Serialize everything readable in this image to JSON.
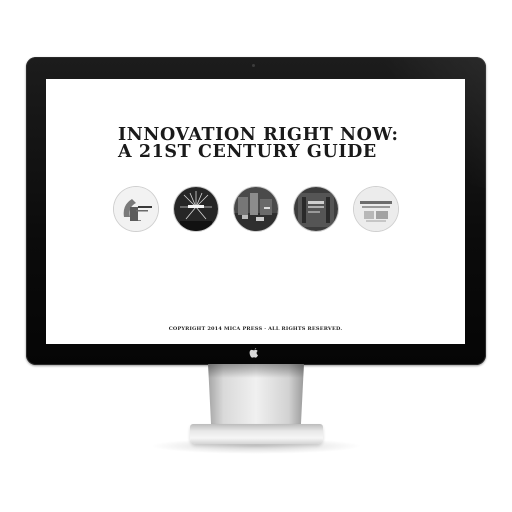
{
  "page": {
    "title_line1": "INNOVATION RIGHT NOW:",
    "title_line2": "A 21ST CENTURY GUIDE",
    "copyright": "COPYRIGHT 2014 MICA PRESS · ALL RIGHTS RESERVED."
  },
  "thumbnails": [
    {
      "icon": "introduction-thumbnail"
    },
    {
      "icon": "fireworks-thumbnail"
    },
    {
      "icon": "street-scene-thumbnail"
    },
    {
      "icon": "building-facade-thumbnail"
    },
    {
      "icon": "product-collage-thumbnail"
    }
  ],
  "device": {
    "brand_icon": "apple-icon"
  },
  "colors": {
    "bezel": "#0b0b0b",
    "screen": "#ffffff",
    "title_text": "#1a1a1a",
    "stand": "#e6e6e6"
  }
}
